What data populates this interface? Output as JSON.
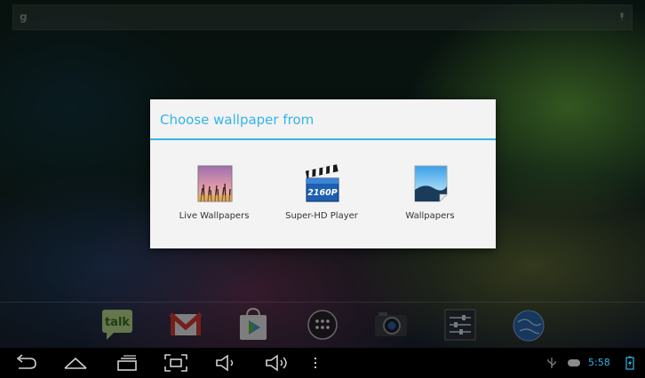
{
  "search": {
    "google_glyph": "g"
  },
  "dialog": {
    "title": "Choose wallpaper from",
    "options": [
      {
        "label": "Live Wallpapers",
        "icon": "live-wallpapers-icon"
      },
      {
        "label": "Super-HD Player",
        "icon": "super-hd-player-icon",
        "badge": "2160P"
      },
      {
        "label": "Wallpapers",
        "icon": "wallpapers-icon"
      }
    ]
  },
  "dock": {
    "apps": [
      {
        "name": "talk",
        "label": "talk",
        "icon": "talk-icon"
      },
      {
        "name": "gmail",
        "icon": "gmail-icon"
      },
      {
        "name": "play-store",
        "icon": "play-store-icon"
      },
      {
        "name": "all-apps",
        "icon": "all-apps-icon"
      },
      {
        "name": "camera",
        "icon": "camera-icon"
      },
      {
        "name": "settings",
        "icon": "settings-icon"
      },
      {
        "name": "browser",
        "icon": "browser-icon"
      }
    ]
  },
  "status": {
    "time": "5:58"
  },
  "colors": {
    "accent": "#33b5e5",
    "dialog_bg": "#f3f3f3",
    "navbar_bg": "#000000"
  }
}
